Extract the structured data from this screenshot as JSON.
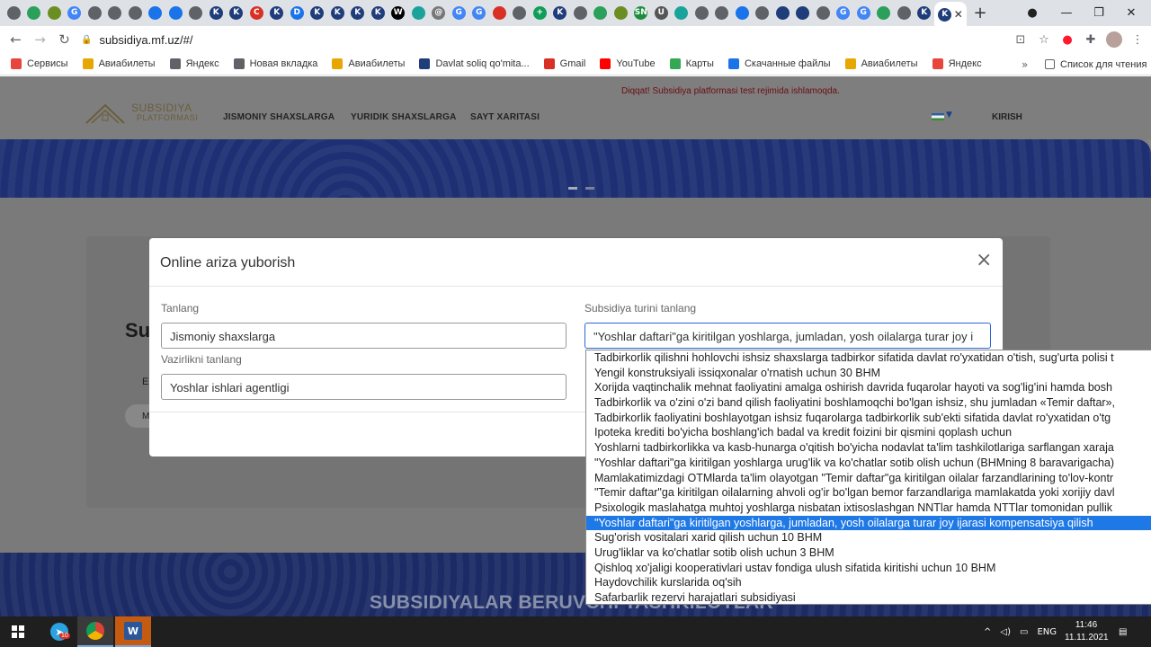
{
  "browser": {
    "tabs": [
      {
        "icon": "chrome-icon",
        "glyph": "",
        "color": "#5f6368"
      },
      {
        "icon": "soliq-icon",
        "glyph": "",
        "color": "#2aa05a"
      },
      {
        "icon": "globe-icon",
        "glyph": "",
        "color": "#6b8e23"
      },
      {
        "icon": "google-icon",
        "glyph": "G",
        "color": "#4285f4"
      },
      {
        "icon": "chrome-icon",
        "glyph": "",
        "color": "#5f6368"
      },
      {
        "icon": "chrome-icon",
        "glyph": "",
        "color": "#5f6368"
      },
      {
        "icon": "chrome-icon",
        "glyph": "",
        "color": "#5f6368"
      },
      {
        "icon": "chat-icon",
        "glyph": "",
        "color": "#1a73e8"
      },
      {
        "icon": "chat-icon",
        "glyph": "",
        "color": "#1a73e8"
      },
      {
        "icon": "chrome-icon",
        "glyph": "",
        "color": "#5f6368"
      },
      {
        "icon": "k-icon",
        "glyph": "K",
        "color": "#1f3d7a"
      },
      {
        "icon": "k-icon",
        "glyph": "K",
        "color": "#1f3d7a"
      },
      {
        "icon": "red-c-icon",
        "glyph": "C",
        "color": "#d93025"
      },
      {
        "icon": "k-icon",
        "glyph": "K",
        "color": "#1f3d7a"
      },
      {
        "icon": "d-icon",
        "glyph": "D",
        "color": "#1a73e8"
      },
      {
        "icon": "k-icon",
        "glyph": "K",
        "color": "#1f3d7a"
      },
      {
        "icon": "k-icon",
        "glyph": "K",
        "color": "#1f3d7a"
      },
      {
        "icon": "k-icon",
        "glyph": "K",
        "color": "#1f3d7a"
      },
      {
        "icon": "k-icon",
        "glyph": "K",
        "color": "#1f3d7a"
      },
      {
        "icon": "w-icon",
        "glyph": "W",
        "color": "#000000"
      },
      {
        "icon": "eye-icon",
        "glyph": "",
        "color": "#1aa39a"
      },
      {
        "icon": "at-icon",
        "glyph": "@",
        "color": "#777777"
      },
      {
        "icon": "google-icon",
        "glyph": "G",
        "color": "#4285f4"
      },
      {
        "icon": "google-icon",
        "glyph": "G",
        "color": "#4285f4"
      },
      {
        "icon": "red-badge-icon",
        "glyph": "",
        "color": "#d93025"
      },
      {
        "icon": "chrome-icon",
        "glyph": "",
        "color": "#5f6368"
      },
      {
        "icon": "plus-green-icon",
        "glyph": "+",
        "color": "#0f9d58"
      },
      {
        "icon": "k-icon",
        "glyph": "K",
        "color": "#1f3d7a"
      },
      {
        "icon": "chrome-icon",
        "glyph": "",
        "color": "#5f6368"
      },
      {
        "icon": "soliq-icon",
        "glyph": "",
        "color": "#2aa05a"
      },
      {
        "icon": "globe-icon",
        "glyph": "",
        "color": "#6b8e23"
      },
      {
        "icon": "sn-icon",
        "glyph": "SN",
        "color": "#1e8e3e"
      },
      {
        "icon": "uza-icon",
        "glyph": "U",
        "color": "#555555"
      },
      {
        "icon": "eye-icon",
        "glyph": "",
        "color": "#1aa39a"
      },
      {
        "icon": "chrome-icon",
        "glyph": "",
        "color": "#5f6368"
      },
      {
        "icon": "chrome-icon",
        "glyph": "",
        "color": "#5f6368"
      },
      {
        "icon": "chart-icon",
        "glyph": "",
        "color": "#1a73e8"
      },
      {
        "icon": "chrome-icon",
        "glyph": "",
        "color": "#5f6368"
      },
      {
        "icon": "news-icon",
        "glyph": "",
        "color": "#1f3d7a"
      },
      {
        "icon": "map-icon",
        "glyph": "",
        "color": "#1f3d7a"
      },
      {
        "icon": "chrome-icon",
        "glyph": "",
        "color": "#5f6368"
      },
      {
        "icon": "google-icon",
        "glyph": "G",
        "color": "#4285f4"
      },
      {
        "icon": "google-icon",
        "glyph": "G",
        "color": "#4285f4"
      },
      {
        "icon": "soliq-icon",
        "glyph": "",
        "color": "#2aa05a"
      },
      {
        "icon": "chrome-icon",
        "glyph": "",
        "color": "#5f6368"
      },
      {
        "icon": "k-icon",
        "glyph": "K",
        "color": "#1f3d7a"
      }
    ],
    "url": "subsidiya.mf.uz/#/",
    "bookmarks": [
      {
        "label": "Сервисы",
        "icon": "apps-icon",
        "color": "#e8453c"
      },
      {
        "label": "Авиабилеты",
        "icon": "plane-tag-icon",
        "color": "#e8a600"
      },
      {
        "label": "Яндекс",
        "icon": "chrome-icon",
        "color": "#5f6368"
      },
      {
        "label": "Новая вкладка",
        "icon": "chrome-icon",
        "color": "#5f6368"
      },
      {
        "label": "Авиабилеты",
        "icon": "plane-tag-icon",
        "color": "#e8a600"
      },
      {
        "label": "Davlat soliq qo'mita...",
        "icon": "k-icon",
        "color": "#1f3d7a"
      },
      {
        "label": "Gmail",
        "icon": "gmail-icon",
        "color": "#d93025"
      },
      {
        "label": "YouTube",
        "icon": "youtube-icon",
        "color": "#ff0000"
      },
      {
        "label": "Карты",
        "icon": "maps-icon",
        "color": "#34a853"
      },
      {
        "label": "Скачанные файлы",
        "icon": "download-icon",
        "color": "#1a73e8"
      },
      {
        "label": "Авиабилеты",
        "icon": "plane-icon",
        "color": "#e8a600"
      },
      {
        "label": "Яндекс",
        "icon": "yandex-icon",
        "color": "#e8453c"
      }
    ],
    "more": "»",
    "reading_list": "Список для чтения"
  },
  "site": {
    "notice": "Diqqat! Subsidiya platformasi test rejimida ishlamoqda.",
    "logo_line1": "SUBSIDIYA",
    "logo_line2": "PLATFORMASI",
    "nav": [
      "JISMONIY SHAXSLARGA",
      "YURIDIK SHAXSLARGA",
      "SAYT XARITASI"
    ],
    "login": "KIRISH",
    "hero_fragment": "Su",
    "sub_fragment": "E",
    "button_fragment": "M",
    "footer_title": "SUBSIDIYALAR BERUVCHI TASHKILOTLAR"
  },
  "modal": {
    "title": "Online ariza yuborish",
    "close": "×",
    "field1_label": "Tanlang",
    "field1_value": "Jismoniy shaxslarga",
    "field2_label": "Vazirlikni tanlang",
    "field2_value": "Yoshlar ishlari agentligi",
    "field3_label": "Subsidiya turini tanlang",
    "field3_value": "\"Yoshlar daftari\"ga kiritilgan yoshlarga, jumladan, yosh oilalarga turar joy i"
  },
  "dropdown": {
    "options": [
      "Tadbirkorlik qilishni hohlovchi ishsiz shaxslarga tadbirkor sifatida davlat ro'yxatidan o'tish, sug'urta polisi t",
      "Yengil konstruksiyali issiqxonalar o'rnatish uchun 30 BHM",
      "Xorijda vaqtinchalik mehnat faoliyatini amalga oshirish davrida fuqarolar hayoti va sog'lig'ini hamda bosh",
      "Tadbirkorlik va o'zini o'zi band qilish faoliyatini boshlamoqchi bo'lgan ishsiz, shu jumladan «Temir daftar»,",
      "Tadbirkorlik faoliyatini boshlayotgan ishsiz fuqarolarga tadbirkorlik sub'ekti sifatida davlat ro'yxatidan o'tg",
      "Ipoteka krediti bo'yicha boshlang'ich badal va kredit foizini bir qismini qoplash uchun",
      "Yoshlarni tadbirkorlikka va kasb-hunarga o'qitish bo'yicha nodavlat ta'lim tashkilotlariga sarflangan xaraja",
      "\"Yoshlar daftari\"ga kiritilgan yoshlarga urug'lik va ko'chatlar sotib olish uchun (BHMning 8 baravarigacha)",
      "Mamlakatimizdagi OTMlarda ta'lim olayotgan \"Temir daftar\"ga kiritilgan oilalar farzandlarining to'lov-kontr",
      "\"Temir daftar\"ga kiritilgan oilalarning ahvoli og'ir bo'lgan bemor farzandlariga mamlakatda yoki xorijiy davl",
      "Psixologik maslahatga muhtoj yoshlarga nisbatan ixtisoslashgan NNTlar hamda NTTlar tomonidan pullik",
      "\"Yoshlar daftari\"ga kiritilgan yoshlarga, jumladan, yosh oilalarga turar joy ijarasi kompensatsiya qilish",
      " Sug'orish vositalari xarid qilish uchun 10 BHM",
      "Urug'liklar va ko'chatlar sotib olish uchun 3 BHM",
      "Qishloq xo'jaligi kooperativlari ustav fondiga ulush sifatida kiritishi uchun 10 BHM",
      "Haydovchilik kurslarida oq'sih",
      "Safarbarlik rezervi harajatlari subsidiyasi"
    ],
    "selected_index": 11
  },
  "taskbar": {
    "badge_count": "10",
    "language": "ENG",
    "time": "11:46",
    "date": "11.11.2021"
  },
  "colors": {
    "accent": "#1e78e6",
    "banner": "#1e2f73",
    "notice": "#6c0c14"
  }
}
